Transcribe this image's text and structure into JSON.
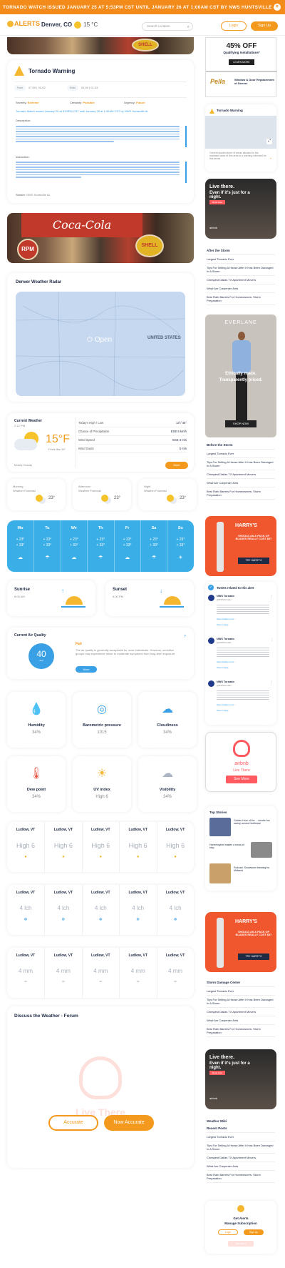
{
  "topbar": {
    "text": "TORNADO WATCH ISSUED JANUARY 25 AT 5:53PM CST UNTIL JANUARY 26 AT 1:00AM CST BY NWS HUNTSVILLE AL"
  },
  "header": {
    "logo": "ALERTS",
    "location": "Denver, CO",
    "temp": "15 °C",
    "search_placeholder": "Search Location",
    "login": "Login",
    "signup": "Sign Up"
  },
  "warning": {
    "title": "Tornado Warning",
    "from_label": "From",
    "from_value": "07:00 | 01-02",
    "to_label": "Ends",
    "to_value": "01:00 | 01-03",
    "severity_label": "Severity:",
    "severity": "Extreme",
    "certainty_label": "Certainty:",
    "certainty": "Possible",
    "urgency_label": "Urgency:",
    "urgency": "Future",
    "summary": "Tornado Watch issued January 25 at 5:53PM CST until January 26 at 1:00AM CST by NWS Huntsville AL",
    "description_label": "Description:",
    "instruction_label": "Instruction:",
    "sender_label": "Sender:",
    "sender": "NWS Huntsville AL"
  },
  "radar": {
    "title": "Denver Weather Radar",
    "open_label": "Open",
    "region": "UNITED STATES"
  },
  "current": {
    "title": "Current Weather",
    "time": "2:12 PM",
    "temp": "15°F",
    "feels": "Feels like 16°",
    "condition": "Mostly Cloudy",
    "rows": [
      {
        "k": "Today's High / Low",
        "v": "13°/ 45°"
      },
      {
        "k": "Chance of Precipitation",
        "v": "ESE 5 km/h"
      },
      {
        "k": "Wind Speed",
        "v": "ESE 3 m/s"
      },
      {
        "k": "Wind Gusts",
        "v": "5 m/s"
      }
    ],
    "more": "More"
  },
  "forecast3": [
    {
      "label": "Morning",
      "sub": "Weather Forecast",
      "temp": "23°"
    },
    {
      "label": "Afternoon",
      "sub": "Weather Forecast",
      "temp": "23°"
    },
    {
      "label": "Night",
      "sub": "Weather Forecast",
      "temp": "23°"
    }
  ],
  "weekly": {
    "days": [
      "Mo",
      "Tu",
      "We",
      "Th",
      "Fr",
      "Sa",
      "Su"
    ],
    "hi": "+ 23°",
    "lo": "+ 33°"
  },
  "sun": {
    "sunrise_label": "Sunrise",
    "sunrise": "6:00 AM",
    "sunset_label": "Sunset",
    "sunset": "6:00 PM"
  },
  "aq": {
    "title": "Current Air Quality",
    "value": "40",
    "unit": "AQI",
    "status": "Fair",
    "text": "The air quality is generally acceptable for most individuals. However, sensitive groups may experience minor to moderate symptoms from long-term exposure.",
    "more": "More"
  },
  "metrics": [
    {
      "name": "Humidity",
      "value": "34%",
      "icon": "humidity-icon"
    },
    {
      "name": "Barometric pressure",
      "value": "1015",
      "icon": "barometer-icon"
    },
    {
      "name": "Cloudiness",
      "value": "34%",
      "icon": "cloud-icon"
    },
    {
      "name": "Dew point",
      "value": "34%",
      "icon": "thermometer-icon"
    },
    {
      "name": "UV index",
      "value": "High 6",
      "icon": "sun-icon"
    },
    {
      "name": "Visibility",
      "value": "34%",
      "icon": "fog-icon"
    }
  ],
  "uvgrid": {
    "place": "Ludlow, VT",
    "value": "High 6"
  },
  "snowgrid": {
    "place": "Ludlow, VT",
    "value": "4 lch"
  },
  "raingrid": {
    "place": "Ludlow, VT",
    "value": "4 mm"
  },
  "forum": {
    "title": "Discuss the Weather - Forum",
    "accurate": "Accurate",
    "now_accurate": "Now Accurate",
    "watermark": "Live There"
  },
  "sidebar": {
    "ad1": {
      "headline": "45% OFF",
      "sub": "Qualifying Installations*",
      "cta": "LEARN MORE",
      "brand": "Pella",
      "brand_sub": "Window & Door Replacement of Denver"
    },
    "map_title": "Tornado Warning",
    "map_text": "Current issues storm of areas situated in the mainland area of this area in a warning intended for this areas",
    "airbnb1": {
      "line1": "Live there.",
      "line2": "Even if it's just for a night.",
      "cta": "Book Now",
      "brand": "airbnb"
    },
    "after_title": "After the Storm",
    "after_items": [
      "Largest Tornado Ever",
      "Tips For Selling A House After It Has Been Damaged In A Storm",
      "Cheapest Dallas TX Apartment Movers",
      "What Are Carpenter Ants",
      "Best Rain Barrels For Homeowners: Storm Preparation"
    ],
    "everlane": {
      "brand": "EVERLANE",
      "tag1": "Ethically made.",
      "tag2": "Transparently priced.",
      "cta": "SHOP NOW"
    },
    "before_title": "Before the Storm",
    "before_items": [
      "Largest Tornado Ever",
      "Tips For Selling A House After It Has Been Damaged In A Storm",
      "Cheapest Dallas TX Apartment Movers",
      "What Are Carpenter Ants",
      "Best Rain Barrels For Homeowners: Storm Preparation"
    ],
    "harrys": {
      "brand": "HARRY'S",
      "text": "SHOULD AN A PACK OF BLADES REALLY COST $5?",
      "cta": "TRY HARRY'S"
    },
    "tweets_title": "Tweets related to this alert",
    "tweets": [
      {
        "name": "NWS Tornado",
        "handle": "@NWSTornado",
        "link": "https://twitter.com/...",
        "show": "Show image"
      },
      {
        "name": "NWS Tornado",
        "handle": "@NWSTornado",
        "link": "https://twitter.com/...",
        "show": "Show image"
      },
      {
        "name": "NWS Tornado",
        "handle": "@NWSTornado",
        "link": "https://twitter.com/...",
        "show": "Show image"
      }
    ],
    "airbnb2": {
      "brand": "airbnb",
      "tag": "Live There",
      "cta": "See More"
    },
    "top_title": "Top Stories",
    "top_items": [
      "Golden Hour of the ... smoke fun sweep across Northeast",
      "Hummingbird makes a snow pit stop",
      "Podcast: Snowstorm brewing for Midwest"
    ],
    "harrys2": {
      "brand": "HARRY'S",
      "text": "SHOULD AN A PACK OF BLADES REALLY COST $5?",
      "cta": "TRY HARRY'S"
    },
    "damage_title": "Storm Damage Center",
    "damage_items": [
      "Largest Tornado Ever",
      "Tips For Selling A House After It Has Been Damaged In A Storm",
      "Cheapest Dallas TX Apartment Movers",
      "What Are Carpenter Ants",
      "Best Rain Barrels For Homeowners: Storm Preparation"
    ],
    "airbnb3": {
      "line1": "Live there.",
      "line2": "Even if it's just for a night.",
      "cta": "Book Now",
      "brand": "airbnb"
    },
    "wiki_title": "Weather Wiki",
    "wiki_sub": "Recent Posts",
    "wiki_items": [
      "Largest Tornado Ever",
      "Tips For Selling A House After It Has Been Damaged In A Storm",
      "Cheapest Dallas TX Apartment Movers",
      "What Are Carpenter Ants",
      "Best Rain Barrels For Homeowners: Storm Preparation"
    ],
    "alerts": {
      "title1": "Get Alerts",
      "title2": "Manage Subscription",
      "login": "Login",
      "signup": "Sign Up",
      "more": "See More"
    }
  }
}
